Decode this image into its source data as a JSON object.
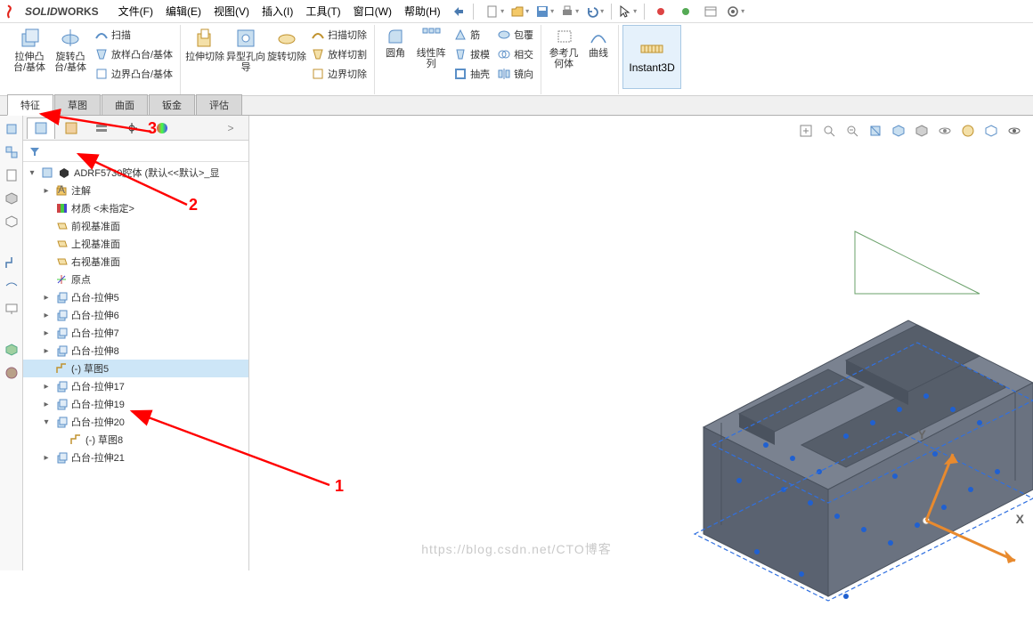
{
  "app": {
    "title": "SOLIDWORKS"
  },
  "menubar": [
    "文件(F)",
    "编辑(E)",
    "视图(V)",
    "插入(I)",
    "工具(T)",
    "窗口(W)",
    "帮助(H)"
  ],
  "ribbon": {
    "extrude_boss": "拉伸凸台/基体",
    "revolve_boss": "旋转凸台/基体",
    "sweep": "扫描",
    "loft_boss": "放样凸台/基体",
    "boundary_boss": "边界凸台/基体",
    "extrude_cut": "拉伸切除",
    "hole_wizard": "异型孔向导",
    "revolve_cut": "旋转切除",
    "swept_cut": "扫描切除",
    "lofted_cut": "放样切割",
    "boundary_cut": "边界切除",
    "fillet": "圆角",
    "linear_pattern": "线性阵列",
    "rib": "筋",
    "draft": "拔模",
    "shell": "抽壳",
    "wrap": "包覆",
    "intersect": "相交",
    "mirror": "镜向",
    "ref_geometry": "参考几何体",
    "curves": "曲线",
    "instant3d": "Instant3D"
  },
  "tabs": [
    "特征",
    "草图",
    "曲面",
    "钣金",
    "评估"
  ],
  "tree": {
    "root": "ADRF5730腔体  (默认<<默认>_显",
    "items": [
      {
        "label": "注解",
        "icon": "folder",
        "exp": "▸",
        "indent": 1
      },
      {
        "label": "材质 <未指定>",
        "icon": "material",
        "exp": "",
        "indent": 1
      },
      {
        "label": "前视基准面",
        "icon": "plane",
        "exp": "",
        "indent": 1
      },
      {
        "label": "上视基准面",
        "icon": "plane",
        "exp": "",
        "indent": 1
      },
      {
        "label": "右视基准面",
        "icon": "plane",
        "exp": "",
        "indent": 1
      },
      {
        "label": "原点",
        "icon": "origin",
        "exp": "",
        "indent": 1
      },
      {
        "label": "凸台-拉伸5",
        "icon": "feature",
        "exp": "▸",
        "indent": 1
      },
      {
        "label": "凸台-拉伸6",
        "icon": "feature",
        "exp": "▸",
        "indent": 1
      },
      {
        "label": "凸台-拉伸7",
        "icon": "feature",
        "exp": "▸",
        "indent": 1
      },
      {
        "label": "凸台-拉伸8",
        "icon": "feature",
        "exp": "▸",
        "indent": 1
      },
      {
        "label": "(-) 草图5",
        "icon": "sketch",
        "exp": "",
        "indent": 1,
        "selected": true
      },
      {
        "label": "凸台-拉伸17",
        "icon": "feature",
        "exp": "▸",
        "indent": 1
      },
      {
        "label": "凸台-拉伸19",
        "icon": "feature",
        "exp": "▸",
        "indent": 1
      },
      {
        "label": "凸台-拉伸20",
        "icon": "feature",
        "exp": "▾",
        "indent": 1
      },
      {
        "label": "(-) 草图8",
        "icon": "sketch",
        "exp": "",
        "indent": 2
      },
      {
        "label": "凸台-拉伸21",
        "icon": "feature",
        "exp": "▸",
        "indent": 1
      }
    ]
  },
  "annotations": {
    "1": "1",
    "2": "2",
    "3": "3"
  },
  "axes": {
    "x": "X",
    "y": "Y"
  },
  "watermark": "https://blog.csdn.net/CTO博客"
}
